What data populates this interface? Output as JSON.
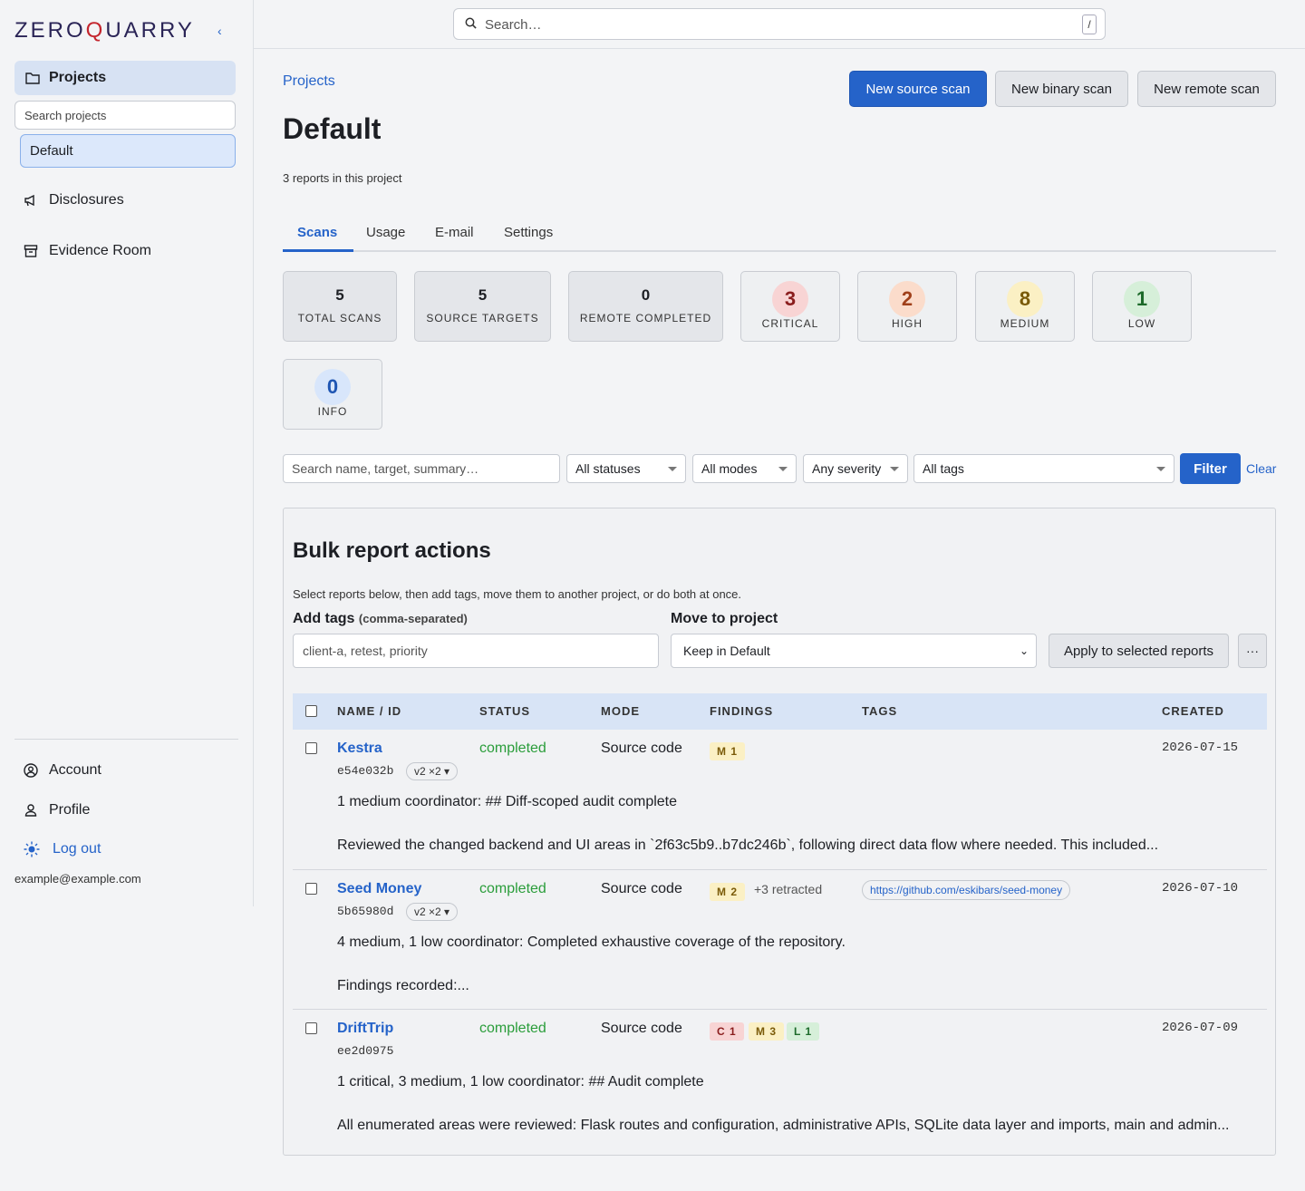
{
  "sidebar": {
    "logo": "ZEROQUARRY",
    "collapse_icon": "chevron-left-icon",
    "projects_label": "Projects",
    "search_placeholder": "Search projects",
    "project_items": [
      "Default"
    ],
    "disclosures_label": "Disclosures",
    "evidence_label": "Evidence Room",
    "account_label": "Account",
    "profile_label": "Profile",
    "logout_label": "Log out",
    "email": "example@example.com"
  },
  "topbar": {
    "search_placeholder": "Search…",
    "shortcut": "/"
  },
  "header": {
    "breadcrumb": "Projects",
    "title": "Default",
    "subtitle": "3 reports in this project",
    "buttons": {
      "new_source": "New source scan",
      "new_binary": "New binary scan",
      "new_remote": "New remote scan"
    }
  },
  "tabs": [
    "Scans",
    "Usage",
    "E-mail",
    "Settings"
  ],
  "stats": {
    "total_scans": {
      "value": "5",
      "label": "TOTAL SCANS"
    },
    "source_targets": {
      "value": "5",
      "label": "SOURCE TARGETS"
    },
    "remote_completed": {
      "value": "0",
      "label": "REMOTE COMPLETED"
    },
    "critical": {
      "value": "3",
      "label": "CRITICAL",
      "color": "#8a1d1d",
      "bg": "#f8d4d4"
    },
    "high": {
      "value": "2",
      "label": "HIGH",
      "color": "#a0401a",
      "bg": "#fbdccb"
    },
    "medium": {
      "value": "8",
      "label": "MEDIUM",
      "color": "#7a5a08",
      "bg": "#fbf0c4"
    },
    "low": {
      "value": "1",
      "label": "LOW",
      "color": "#1d6a2a",
      "bg": "#d6efd9"
    },
    "info": {
      "value": "0",
      "label": "INFO",
      "color": "#1f56b3",
      "bg": "#d8e6fb"
    }
  },
  "filters": {
    "search_placeholder": "Search name, target, summary…",
    "status": "All statuses",
    "mode": "All modes",
    "severity": "Any severity",
    "tags": "All tags",
    "filter_btn": "Filter",
    "clear": "Clear"
  },
  "bulk": {
    "title": "Bulk report actions",
    "description": "Select reports below, then add tags, move them to another project, or do both at once.",
    "tags_label": "Add tags",
    "tags_hint": "(comma-separated)",
    "tags_placeholder": "client-a, retest, priority",
    "move_label": "Move to project",
    "move_value": "Keep in Default",
    "apply": "Apply to selected reports",
    "more": "···"
  },
  "table": {
    "headers": [
      "NAME / ID",
      "STATUS",
      "MODE",
      "FINDINGS",
      "TAGS",
      "CREATED"
    ],
    "rows": [
      {
        "name": "Kestra",
        "id": "e54e032b",
        "version": "v2 ×2 ▾",
        "status": "completed",
        "mode": "Source code",
        "findings": [
          "M 1"
        ],
        "created": "2026-07-15",
        "summary1": "1 medium coordinator: ## Diff-scoped audit complete",
        "summary2": "Reviewed the changed backend and UI areas in `2f63c5b9..b7dc246b`, following direct data flow where needed. This included..."
      },
      {
        "name": "Seed Money",
        "id": "5b65980d",
        "version": "v2 ×2 ▾",
        "status": "completed",
        "mode": "Source code",
        "findings": [
          "M 2"
        ],
        "retracted": "+3 retracted",
        "tag": "https://github.com/eskibars/seed-money",
        "created": "2026-07-10",
        "summary1": "4 medium, 1 low coordinator: Completed exhaustive coverage of the repository.",
        "summary2": "Findings recorded:..."
      },
      {
        "name": "DriftTrip",
        "id": "ee2d0975",
        "status": "completed",
        "mode": "Source code",
        "findings": [
          "C 1",
          "M 3",
          "L 1"
        ],
        "created": "2026-07-09",
        "summary1": "1 critical, 3 medium, 1 low coordinator: ## Audit complete",
        "summary2": "All enumerated areas were reviewed: Flask routes and configuration, administrative APIs, SQLite data layer and imports, main and admin..."
      }
    ]
  }
}
